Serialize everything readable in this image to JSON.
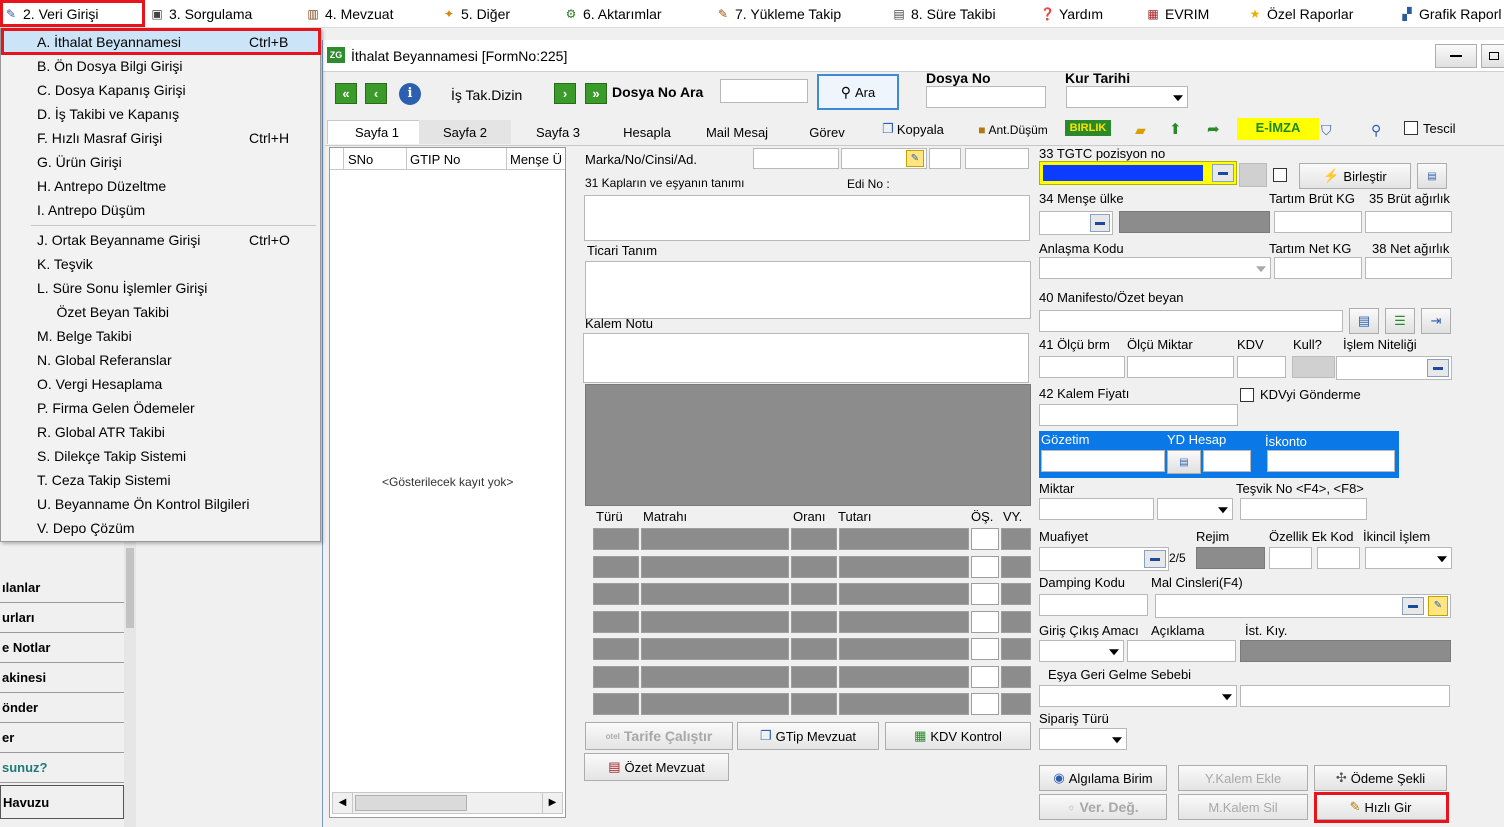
{
  "menubar": {
    "items": [
      {
        "label": "2.  Veri Girişi",
        "icon": "pencil-icon"
      },
      {
        "label": "3.  Sorgulama",
        "icon": "query-icon"
      },
      {
        "label": "4.  Mevzuat",
        "icon": "books-icon"
      },
      {
        "label": "5.  Diğer",
        "icon": "other-icon"
      },
      {
        "label": "6.  Aktarımlar",
        "icon": "transfer-icon"
      },
      {
        "label": "7.  Yükleme Takip",
        "icon": "truck-icon"
      },
      {
        "label": "8. Süre Takibi",
        "icon": "timer-icon"
      },
      {
        "label": "Yardım",
        "icon": "help-icon"
      },
      {
        "label": "EVRIM",
        "icon": "evrim-icon"
      },
      {
        "label": "Özel Raporlar",
        "icon": "star-icon"
      },
      {
        "label": "Grafik Raporl",
        "icon": "chart-icon"
      }
    ]
  },
  "dropdown": {
    "items": [
      {
        "label": "A.  İthalat Beyannamesi",
        "shortcut": "Ctrl+B"
      },
      {
        "label": "B.  Ön Dosya Bilgi Girişi",
        "shortcut": ""
      },
      {
        "label": "C.  Dosya Kapanış Girişi",
        "shortcut": ""
      },
      {
        "label": "D.  İş Takibi ve Kapanış",
        "shortcut": ""
      },
      {
        "label": "F.  Hızlı Masraf Girişi",
        "shortcut": "Ctrl+H"
      },
      {
        "label": "G.  Ürün Girişi",
        "shortcut": ""
      },
      {
        "label": "H.  Antrepo Düzeltme",
        "shortcut": ""
      },
      {
        "label": "I.   Antrepo Düşüm",
        "shortcut": ""
      },
      {
        "label": "J.  Ortak Beyanname Girişi",
        "shortcut": "Ctrl+O"
      },
      {
        "label": "K.  Teşvik",
        "shortcut": ""
      },
      {
        "label": "L.  Süre Sonu İşlemler Girişi",
        "shortcut": ""
      },
      {
        "label": "     Özet Beyan Takibi",
        "shortcut": ""
      },
      {
        "label": "M.  Belge Takibi",
        "shortcut": ""
      },
      {
        "label": "N.  Global Referanslar",
        "shortcut": ""
      },
      {
        "label": "O. Vergi Hesaplama",
        "shortcut": ""
      },
      {
        "label": "P. Firma Gelen Ödemeler",
        "shortcut": ""
      },
      {
        "label": "R. Global ATR Takibi",
        "shortcut": ""
      },
      {
        "label": "S. Dilekçe Takip Sistemi",
        "shortcut": ""
      },
      {
        "label": "T. Ceza Takip Sistemi",
        "shortcut": ""
      },
      {
        "label": "U. Beyanname Ön Kontrol Bilgileri",
        "shortcut": ""
      },
      {
        "label": "V. Depo Çözüm",
        "shortcut": ""
      }
    ]
  },
  "sidebar": {
    "items": [
      "ılanlar",
      "urları",
      "e Notlar",
      "akinesi",
      "önder",
      "er",
      "sunuz?",
      "Havuzu"
    ]
  },
  "window": {
    "title": "İthalat Beyannamesi [FormNo:225]",
    "toolbar": {
      "is_takip": "İş Tak.Dizin",
      "dosya_no_ara": "Dosya No Ara",
      "ara": "Ara",
      "dosya_no_label": "Dosya No",
      "kur_tarihi_label": "Kur Tarihi"
    },
    "tabs": [
      "Sayfa 1",
      "Sayfa 2",
      "Sayfa 3",
      "Hesapla",
      "Mail Mesaj",
      "Görev",
      "Kopyala",
      "Ant.Düşüm",
      "BIRLIK",
      "E-İMZA",
      "Tescil"
    ],
    "list": {
      "columns": [
        "SNo",
        "GTIP No",
        "Menşe Ü"
      ],
      "empty": "<Gösterilecek kayıt yok>"
    },
    "middle": {
      "marka": "Marka/No/Cinsi/Ad.",
      "kaplar": "31 Kapların ve eşyanın tanımı",
      "edi_no": "Edi No :",
      "ticari_tanim": "Ticari Tanım",
      "kalem_notu": "Kalem Notu",
      "tax_cols": [
        "Türü",
        "Matrahı",
        "Oranı",
        "Tutarı",
        "ÖŞ.",
        "VY."
      ],
      "tarife": "Tarife Çalıştır",
      "gtip_mevzuat": "GTip Mevzuat",
      "kdv_kontrol": "KDV Kontrol",
      "ozet_mevzuat": "Özet Mevzuat"
    },
    "right": {
      "tgtc": "33 TGTC pozisyon no",
      "birlestir": "Birleştir",
      "mense": "34 Menşe ülke",
      "tartim_brut": "Tartım Brüt KG",
      "brut": "35 Brüt ağırlık",
      "anlasma": "Anlaşma Kodu",
      "tartim_net": "Tartım Net KG",
      "net": "38 Net ağırlık",
      "manifesto": "40 Manifesto/Özet beyan",
      "olcu_brm": "41 Ölçü brm",
      "olcu_miktar": "Ölçü Miktar",
      "kdv": "KDV",
      "kull": "Kull?",
      "islem_niteligi": "İşlem Niteliği",
      "kalem_fiyati": "42 Kalem Fiyatı",
      "kdvyi_gonderme": "KDVyi Gönderme",
      "gozetim": "Gözetim",
      "yd_hesap": "YD Hesap",
      "iskonto": "İskonto",
      "miktar": "Miktar",
      "tesvik_no": "Teşvik No <F4>, <F8>",
      "muafiyet": "Muafiyet",
      "muafiyet_count": "2/5",
      "rejim": "Rejim",
      "ozellik_ek_kod": "Özellik Ek Kod",
      "ikincil_islem": "İkincil İşlem",
      "damping": "Damping Kodu",
      "mal_cinsleri": "Mal Cinsleri(F4)",
      "giris_cikis": "Giriş Çıkış Amacı",
      "aciklama": "Açıklama",
      "ist_kiy": "İst. Kıy.",
      "esya_geri": "Eşya Geri Gelme Sebebi",
      "siparis": "Sipariş Türü",
      "algilama": "Algılama Birim",
      "ykalem_ekle": "Y.Kalem Ekle",
      "odeme_sekli": "Ödeme Şekli",
      "ver_deg": "Ver. Değ.",
      "mkalem_sil": "M.Kalem Sil",
      "hizli_gir": "Hızlı Gir"
    }
  }
}
